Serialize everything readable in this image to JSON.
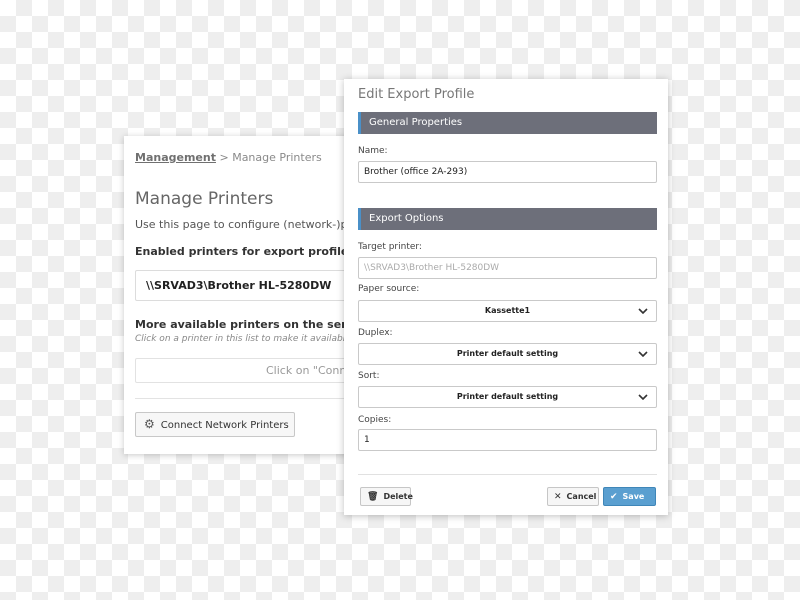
{
  "manage_printers": {
    "breadcrumb": {
      "root": "Management",
      "separator": ">",
      "current": "Manage Printers"
    },
    "title": "Manage Printers",
    "description": "Use this page to configure (network-)printe",
    "enabled_heading": "Enabled printers for export profiles:",
    "enabled_printer": "\\\\SRVAD3\\Brother HL-5280DW",
    "more_heading": "More available printers on the server:",
    "more_hint": "Click on a printer in this list to make it available for",
    "connect_placeholder_text": "Click on \"Conne",
    "connect_button": "Connect Network Printers",
    "connect_icon": "gear-icon"
  },
  "edit_profile": {
    "title": "Edit Export Profile",
    "general_section": "General Properties",
    "name_label": "Name:",
    "name_value": "Brother (office 2A-293)",
    "export_section": "Export Options",
    "target_label": "Target printer:",
    "target_placeholder": "\\\\SRVAD3\\Brother HL-5280DW",
    "paper_label": "Paper source:",
    "paper_value": "Kassette1",
    "duplex_label": "Duplex:",
    "duplex_value": "Printer default setting",
    "sort_label": "Sort:",
    "sort_value": "Printer default setting",
    "copies_label": "Copies:",
    "copies_value": "1",
    "delete_button": "Delete",
    "cancel_button": "Cancel",
    "save_button": "Save",
    "section_accent_color": "#4a90c8",
    "section_bar_color": "#6d6f7a",
    "save_button_color": "#5a9fd0"
  }
}
